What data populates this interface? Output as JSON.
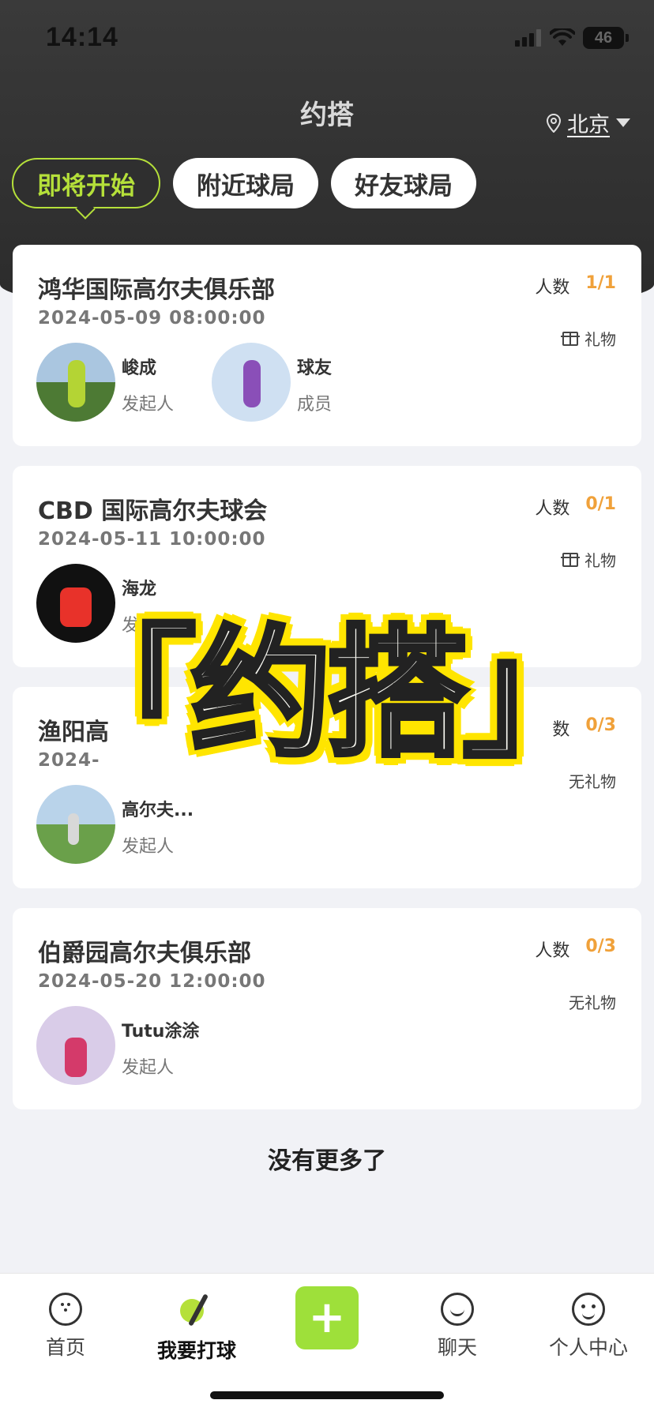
{
  "status": {
    "time": "14:14",
    "battery": "46"
  },
  "header": {
    "title": "约搭",
    "city": "北京"
  },
  "tabs": [
    {
      "label": "即将开始",
      "active": true
    },
    {
      "label": "附近球局",
      "active": false
    },
    {
      "label": "好友球局",
      "active": false
    }
  ],
  "cards": [
    {
      "title": "鸿华国际高尔夫俱乐部",
      "time": "2024-05-09 08:00:00",
      "count_label": "人数",
      "count": "1/1",
      "gift": "礼物",
      "people": [
        {
          "name": "峻成",
          "role": "发起人"
        },
        {
          "name": "球友",
          "role": "成员"
        }
      ]
    },
    {
      "title": "CBD 国际高尔夫球会",
      "time": "2024-05-11 10:00:00",
      "count_label": "人数",
      "count": "0/1",
      "gift": "礼物",
      "people": [
        {
          "name": "海龙",
          "role": "发起人"
        }
      ]
    },
    {
      "title": "渔阳高",
      "time": "2024-",
      "count_label": "数",
      "count": "0/3",
      "gift": "无礼物",
      "people": [
        {
          "name": "高尔夫...",
          "role": "发起人"
        }
      ]
    },
    {
      "title": "伯爵园高尔夫俱乐部",
      "time": "2024-05-20 12:00:00",
      "count_label": "人数",
      "count": "0/3",
      "gift": "无礼物",
      "people": [
        {
          "name": "Tutu涂涂",
          "role": "发起人"
        }
      ]
    }
  ],
  "footer_text": "没有更多了",
  "overlay_text": "「约搭」",
  "bottom_nav": [
    {
      "label": "首页",
      "icon": "golf-ball-icon"
    },
    {
      "label": "我要打球",
      "icon": "golf-club-icon",
      "active": true
    },
    {
      "label": "",
      "icon": "plus-icon"
    },
    {
      "label": "聊天",
      "icon": "chat-icon"
    },
    {
      "label": "个人中心",
      "icon": "smile-icon"
    }
  ],
  "colors": {
    "accent": "#b5e03a",
    "count": "#f0a13a",
    "header_bg": "#2f2f2f",
    "add_button": "#9ee03a"
  }
}
